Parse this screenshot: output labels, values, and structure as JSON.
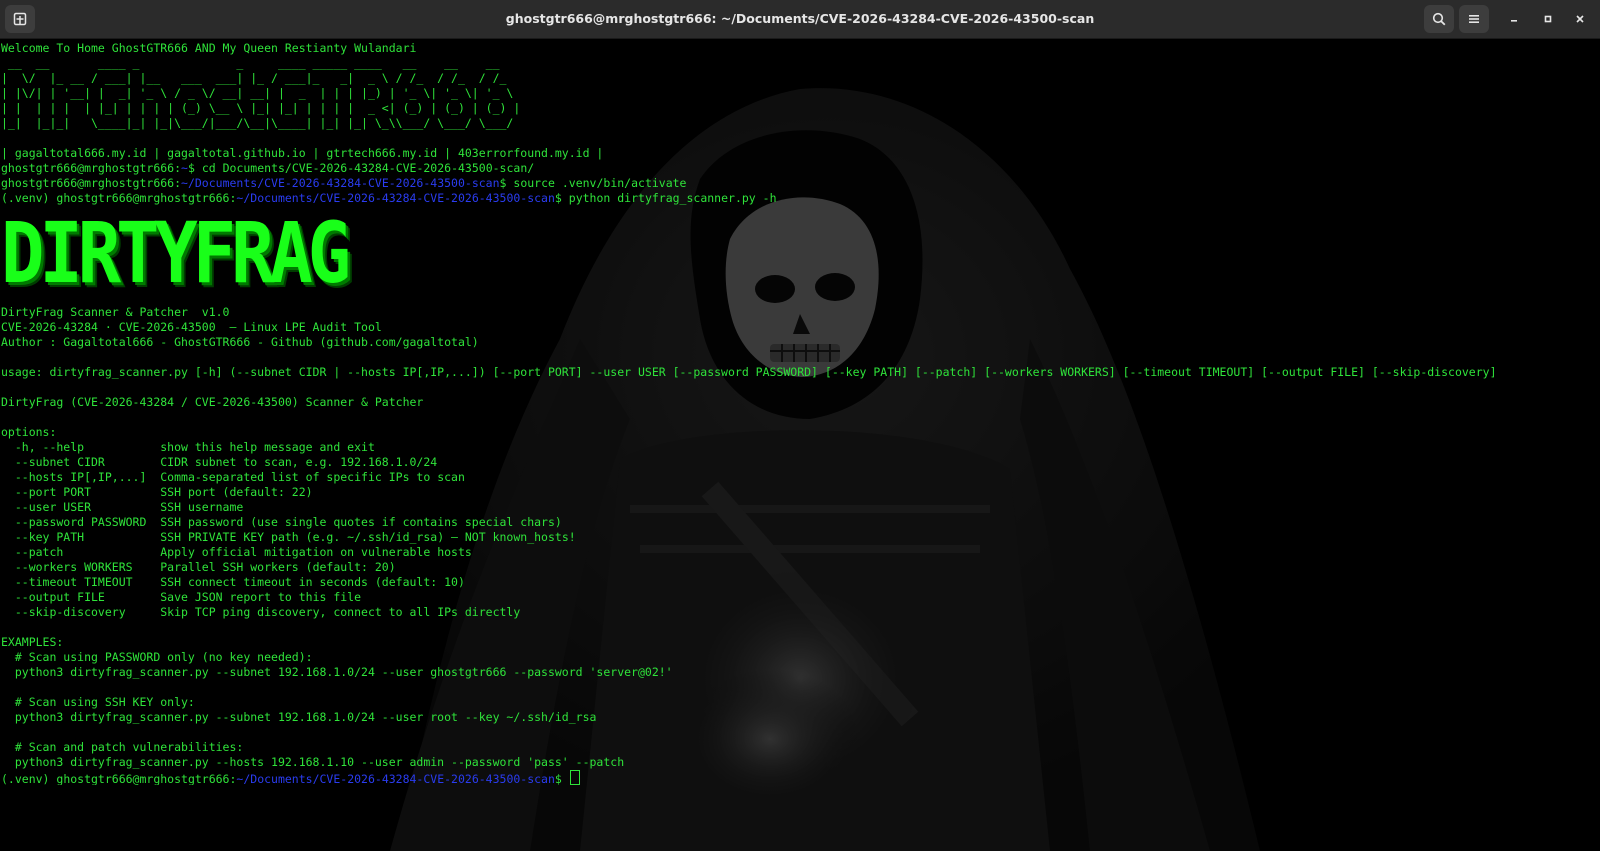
{
  "window": {
    "title": "ghostgtr666@mrghostgtr666: ~/Documents/CVE-2026-43284-CVE-2026-43500-scan",
    "new_tab_icon": "new-tab-icon",
    "search_icon": "search-icon",
    "menu_icon": "hamburger-menu-icon",
    "minimize_icon": "minimize-icon",
    "maximize_icon": "maximize-icon",
    "close_icon": "close-icon"
  },
  "colors": {
    "text": "#2fe33a",
    "path": "#2a3cf0",
    "banner": "#19ff19",
    "titlebar": "#2b2b2b"
  },
  "terminal": {
    "welcome": "Welcome To Home GhostGTR666 AND My Queen Restianty Wulandari",
    "ascii_art": [
      " __  __       ____ _              _     ____ _____ ____   __    __    __",
      "|  \\/  |_ __ / ___| |__   ___  ___| |_ / ___|_   _|  _ \\ / /_  / /_  / /_",
      "| |\\/| | '__| |  _| '_ \\ / _ \\/ __| __| |  _  | | | |_) | '_ \\| '_ \\| '_ \\",
      "| |  | | |  | |_| | | | | (_) \\__ \\ |_| |_| | | | |  _ <| (_) | (_) | (_) |",
      "|_|  |_|_|   \\____|_| |_|\\___/|___/\\__|\\____| |_| |_| \\_\\\\___/ \\___/ \\___/"
    ],
    "links": "| gagaltotal666.my.id | gagaltotal.github.io | gtrtech666.my.id | 403errorfound.my.id |",
    "prompt_user": "ghostgtr666@mrghostgtr666",
    "venv": "(.venv) ",
    "cmd1_path": "~",
    "cmd1": "cd Documents/CVE-2026-43284-CVE-2026-43500-scan/",
    "scan_path": "~/Documents/CVE-2026-43284-CVE-2026-43500-scan",
    "cmd2": "source .venv/bin/activate",
    "cmd3": "python dirtyfrag_scanner.py -h",
    "banner": "DIRTYFRAG",
    "info": [
      "DirtyFrag Scanner & Patcher  v1.0",
      "CVE-2026-43284 · CVE-2026-43500  — Linux LPE Audit Tool",
      "Author : Gagaltotal666 - GhostGTR666 - Github (github.com/gagaltotal)"
    ],
    "usage": "usage: dirtyfrag_scanner.py [-h] (--subnet CIDR | --hosts IP[,IP,...]) [--port PORT] --user USER [--password PASSWORD] [--key PATH] [--patch] [--workers WORKERS] [--timeout TIMEOUT] [--output FILE] [--skip-discovery]",
    "description": "DirtyFrag (CVE-2026-43284 / CVE-2026-43500) Scanner & Patcher",
    "options_header": "options:",
    "options": [
      {
        "flag": "  -h, --help           ",
        "desc": "show this help message and exit"
      },
      {
        "flag": "  --subnet CIDR        ",
        "desc": "CIDR subnet to scan, e.g. 192.168.1.0/24"
      },
      {
        "flag": "  --hosts IP[,IP,...]  ",
        "desc": "Comma-separated list of specific IPs to scan"
      },
      {
        "flag": "  --port PORT          ",
        "desc": "SSH port (default: 22)"
      },
      {
        "flag": "  --user USER          ",
        "desc": "SSH username"
      },
      {
        "flag": "  --password PASSWORD  ",
        "desc": "SSH password (use single quotes if contains special chars)"
      },
      {
        "flag": "  --key PATH           ",
        "desc": "SSH PRIVATE KEY path (e.g. ~/.ssh/id_rsa) — NOT known_hosts!"
      },
      {
        "flag": "  --patch              ",
        "desc": "Apply official mitigation on vulnerable hosts"
      },
      {
        "flag": "  --workers WORKERS    ",
        "desc": "Parallel SSH workers (default: 20)"
      },
      {
        "flag": "  --timeout TIMEOUT    ",
        "desc": "SSH connect timeout in seconds (default: 10)"
      },
      {
        "flag": "  --output FILE        ",
        "desc": "Save JSON report to this file"
      },
      {
        "flag": "  --skip-discovery     ",
        "desc": "Skip TCP ping discovery, connect to all IPs directly"
      }
    ],
    "examples_header": "EXAMPLES:",
    "examples": [
      {
        "comment": "  # Scan using PASSWORD only (no key needed):",
        "cmd": "  python3 dirtyfrag_scanner.py --subnet 192.168.1.0/24 --user ghostgtr666 --password 'server@02!'"
      },
      {
        "comment": "  # Scan using SSH KEY only:",
        "cmd": "  python3 dirtyfrag_scanner.py --subnet 192.168.1.0/24 --user root --key ~/.ssh/id_rsa"
      },
      {
        "comment": "  # Scan and patch vulnerabilities:",
        "cmd": "  python3 dirtyfrag_scanner.py --hosts 192.168.1.10 --user admin --password 'pass' --patch"
      }
    ]
  }
}
